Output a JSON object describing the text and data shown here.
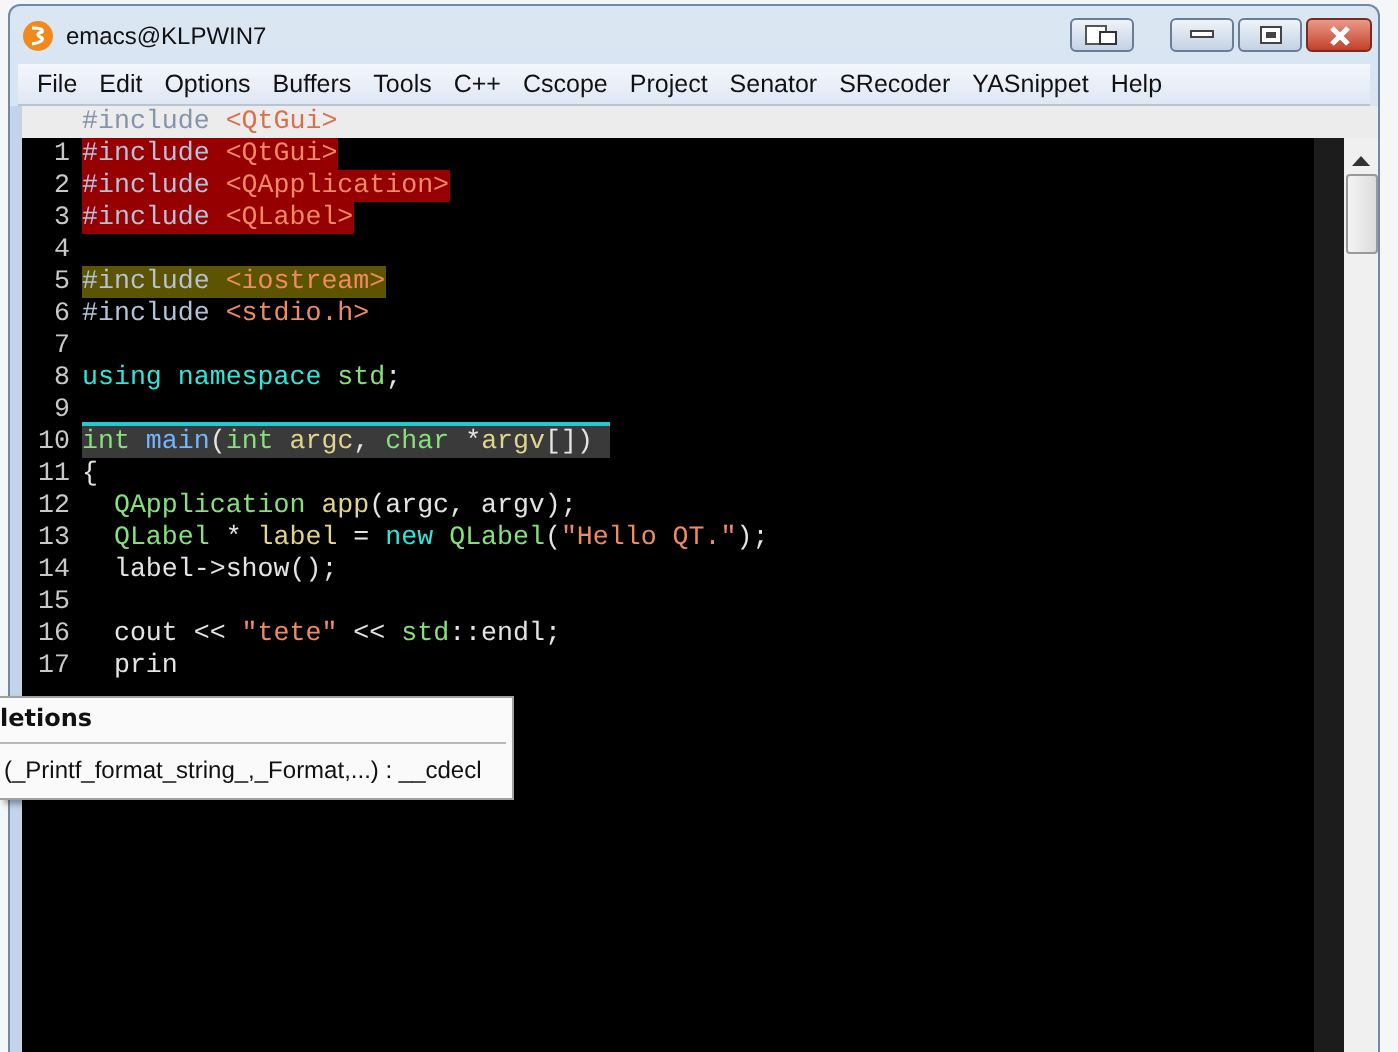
{
  "window": {
    "title": "emacs@KLPWIN7"
  },
  "menu": [
    "File",
    "Edit",
    "Options",
    "Buffers",
    "Tools",
    "C++",
    "Cscope",
    "Project",
    "Senator",
    "SRecoder",
    "YASnippet",
    "Help"
  ],
  "header_line": [
    {
      "text": "#include",
      "kind": "preproc"
    },
    {
      "text": " <QtGui>",
      "kind": "string"
    }
  ],
  "lines": [
    {
      "number": "1",
      "color": "#960000",
      "current": false,
      "tokens": [
        {
          "text": "#include",
          "kind": "preproc"
        },
        {
          "text": " <QtGui>",
          "kind": "string"
        }
      ]
    },
    {
      "number": "2",
      "color": "#960000",
      "current": false,
      "tokens": [
        {
          "text": "#include",
          "kind": "preproc"
        },
        {
          "text": " <QApplication>",
          "kind": "string"
        }
      ]
    },
    {
      "number": "3",
      "color": "#960000",
      "current": false,
      "tokens": [
        {
          "text": "#include",
          "kind": "preproc"
        },
        {
          "text": " <QLabel>",
          "kind": "string"
        }
      ]
    },
    {
      "number": "4",
      "current": false
    },
    {
      "number": "5",
      "color": "#5c5400",
      "current": false,
      "tokens": [
        {
          "text": "#include",
          "kind": "preproc"
        },
        {
          "text": " <iostream>",
          "kind": "string"
        }
      ]
    },
    {
      "number": "6",
      "current": false,
      "tokens": [
        {
          "text": "#include",
          "kind": "preproc"
        },
        {
          "text": " <stdio.h>",
          "kind": "string"
        }
      ]
    },
    {
      "number": "7",
      "current": false
    },
    {
      "number": "8",
      "current": false,
      "tokens": [
        {
          "text": "using namespace",
          "kind": "keyword"
        },
        {
          "text": " std",
          "kind": "type"
        },
        {
          "text": ";",
          "kind": "plain"
        }
      ]
    },
    {
      "number": "9",
      "current": false
    },
    {
      "number": "10",
      "current": true,
      "tokens": [
        {
          "text": "int",
          "kind": "type"
        },
        {
          "text": " main",
          "kind": "function"
        },
        {
          "text": "(",
          "kind": "plain"
        },
        {
          "text": "int",
          "kind": "type"
        },
        {
          "text": " argc",
          "kind": "variable"
        },
        {
          "text": ", ",
          "kind": "plain"
        },
        {
          "text": "char",
          "kind": "type"
        },
        {
          "text": " *",
          "kind": "plain"
        },
        {
          "text": "argv",
          "kind": "variable"
        },
        {
          "text": "[])",
          "kind": "plain"
        }
      ]
    },
    {
      "number": "11",
      "current": false,
      "tokens": [
        {
          "text": "{",
          "kind": "plain"
        }
      ]
    },
    {
      "number": "12",
      "current": false,
      "tokens": [
        {
          "text": "  QApplication",
          "kind": "type"
        },
        {
          "text": " app",
          "kind": "variable"
        },
        {
          "text": "(argc, argv);",
          "kind": "plain"
        }
      ]
    },
    {
      "number": "13",
      "current": false,
      "tokens": [
        {
          "text": "  QLabel",
          "kind": "type"
        },
        {
          "text": " * ",
          "kind": "plain"
        },
        {
          "text": "label",
          "kind": "variable"
        },
        {
          "text": " = ",
          "kind": "plain"
        },
        {
          "text": "new",
          "kind": "keyword"
        },
        {
          "text": " QLabel",
          "kind": "type"
        },
        {
          "text": "(",
          "kind": "plain"
        },
        {
          "text": "\"Hello QT.\"",
          "kind": "string"
        },
        {
          "text": ");",
          "kind": "plain"
        }
      ]
    },
    {
      "number": "14",
      "current": false,
      "tokens": [
        {
          "text": "  label->show();",
          "kind": "plain"
        }
      ]
    },
    {
      "number": "15",
      "current": false
    },
    {
      "number": "16",
      "current": false,
      "tokens": [
        {
          "text": "  cout << ",
          "kind": "plain"
        },
        {
          "text": "\"tete\"",
          "kind": "string"
        },
        {
          "text": " << ",
          "kind": "plain"
        },
        {
          "text": "std",
          "kind": "type"
        },
        {
          "text": "::endl;",
          "kind": "plain"
        }
      ]
    },
    {
      "number": "17",
      "current": false,
      "tokens": [
        {
          "text": "  prin",
          "kind": "plain"
        }
      ]
    }
  ],
  "completion_popup": {
    "title": "letions",
    "items": [
      "(_Printf_format_string_,_Format,...) : __cdecl"
    ]
  }
}
